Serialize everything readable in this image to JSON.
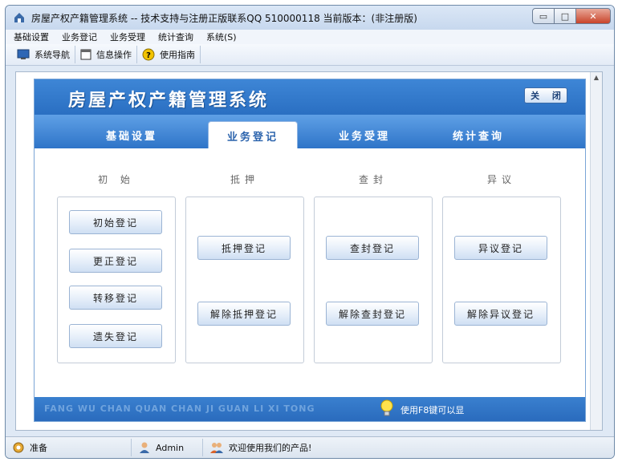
{
  "window": {
    "title": "房屋产权产籍管理系统 -- 技术支持与注册正版联系QQ 510000118    当前版本：(非注册版)",
    "min_label": "▭",
    "max_label": "□",
    "close_label": "✕"
  },
  "menubar": {
    "items": [
      "基础设置",
      "业务登记",
      "业务受理",
      "统计查询",
      "系统(S)"
    ]
  },
  "toolbar": {
    "items": [
      {
        "label": "系统导航",
        "icon": "monitor-icon"
      },
      {
        "label": "信息操作",
        "icon": "window-icon"
      },
      {
        "label": "使用指南",
        "icon": "help-icon"
      }
    ]
  },
  "panel": {
    "title": "房屋产权产籍管理系统",
    "close_label": "关 闭",
    "tabs": [
      "基础设置",
      "业务登记",
      "业务受理",
      "统计查询"
    ],
    "active_tab": 1,
    "columns": [
      {
        "label": "初 始",
        "buttons": [
          "初始登记",
          "更正登记",
          "转移登记",
          "遗失登记"
        ]
      },
      {
        "label": "抵押",
        "buttons": [
          "抵押登记",
          "解除抵押登记"
        ]
      },
      {
        "label": "查封",
        "buttons": [
          "查封登记",
          "解除查封登记"
        ]
      },
      {
        "label": "异议",
        "buttons": [
          "异议登记",
          "解除异议登记"
        ]
      }
    ],
    "footer_pinyin": "FANG WU CHAN QUAN CHAN JI GUAN LI XI TONG",
    "footer_hint": "使用F8键可以显"
  },
  "statusbar": {
    "items": [
      {
        "label": "准备",
        "icon": "gear-user-icon"
      },
      {
        "label": "Admin",
        "icon": "user-icon"
      },
      {
        "label": "欢迎使用我们的产品!",
        "icon": "users-icon"
      }
    ]
  },
  "colors": {
    "accent": "#2a6fc2",
    "tab_active_text": "#2c64ad"
  }
}
